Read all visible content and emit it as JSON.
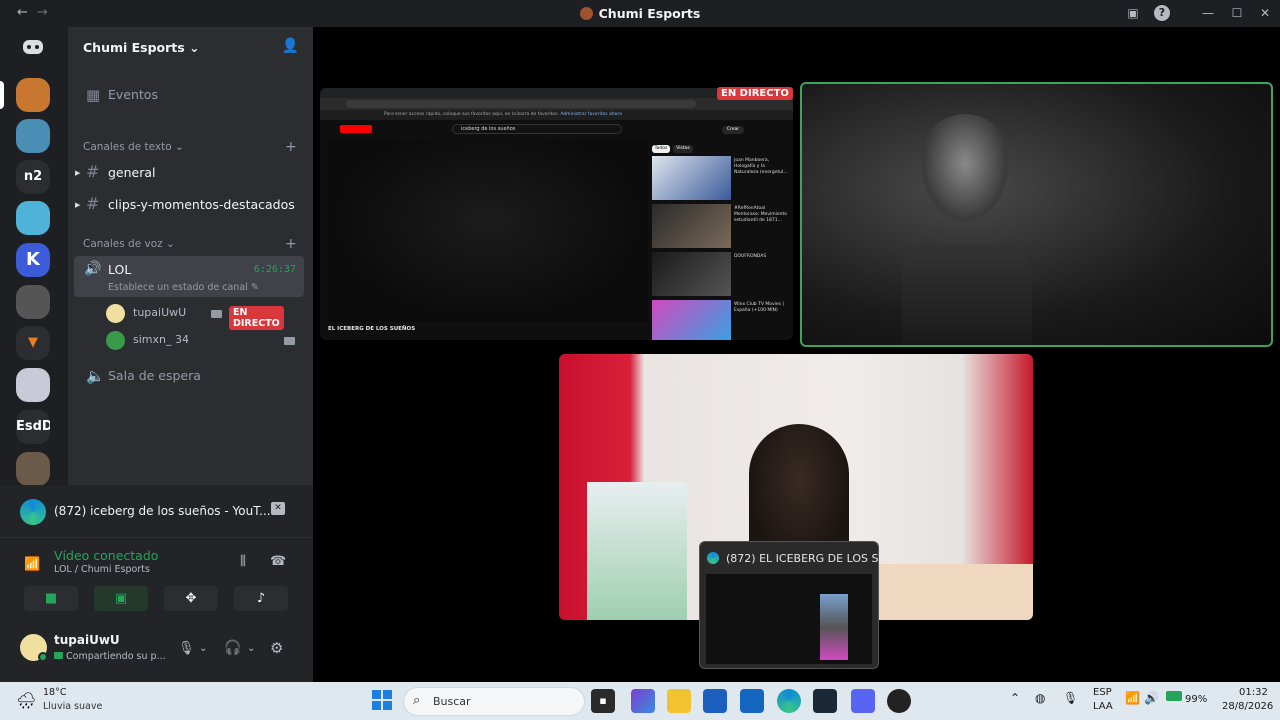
{
  "window": {
    "title": "Chumi Esports"
  },
  "servers": [
    {
      "label": "",
      "color": "#5865f2",
      "icon": "discord-icon"
    },
    {
      "label": "",
      "color": "#c7772f"
    },
    {
      "label": "",
      "color": "#4a8db5"
    },
    {
      "label": "n2",
      "color": "#2b2d31"
    },
    {
      "label": "",
      "color": "#4fb3d9"
    },
    {
      "label": "K",
      "color": "#3c5bd8"
    },
    {
      "label": "",
      "color": "#555555"
    },
    {
      "label": "",
      "color": "#2b2d31"
    },
    {
      "label": "",
      "color": "#c9c9d8"
    },
    {
      "label": "EsdD",
      "color": "#2b2d31"
    },
    {
      "label": "",
      "color": "#6b5a4a"
    }
  ],
  "guild": {
    "name": "Chumi Esports",
    "events_label": "Eventos",
    "text_category": "Canales de texto",
    "text_channels": [
      "general",
      "clips-y-momentos-destacados"
    ],
    "voice_category": "Canales de voz",
    "voice_channel": {
      "name": "LOL",
      "status": "Establece un estado de canal",
      "timer": "6:26:37",
      "members": [
        {
          "name": "tupaiUwU",
          "live": "EN DIRECTO"
        },
        {
          "name": "simxn_ 34"
        }
      ]
    },
    "waiting_room": "Sala de espera"
  },
  "activity": {
    "title": "(872) iceberg de los sueños - YouT..."
  },
  "rtc": {
    "status": "Vídeo conectado",
    "channel": "LOL / Chumi Esports"
  },
  "user": {
    "name": "tupaiUwU",
    "status": "Compartiendo su p..."
  },
  "stage": {
    "stream_live_badge": "EN DIRECTO",
    "browser": {
      "notice": "Para tener acceso rápido, coloque sus favoritos aquí, en la barra de favoritos.",
      "notice_link": "Administrar favoritos ahora",
      "search": "iceberg de los sueños",
      "create": "Crear",
      "filters": [
        "Todos",
        "Vistos"
      ],
      "video_title": "EL ICEBERG DE LOS SUEÑOS",
      "related": [
        "Joan Manboera, Hologafía y la Naturaleza (energetul...",
        "#RefRenAtoal Mentorase: Movimiento estudiantil de 1871...",
        "DOUFRONDAS",
        "Winx Club TV Movies | España (+100 MIN)"
      ]
    },
    "preview_title": "(872) EL ICEBERG DE LOS S..."
  },
  "taskbar": {
    "weather_temp": "18°C",
    "weather_desc": "Lluvia suave",
    "search_placeholder": "Buscar",
    "lang": "ESP",
    "lang2": "LAA",
    "battery": "99%",
    "time": "01:32",
    "date": "28/8/2026"
  }
}
